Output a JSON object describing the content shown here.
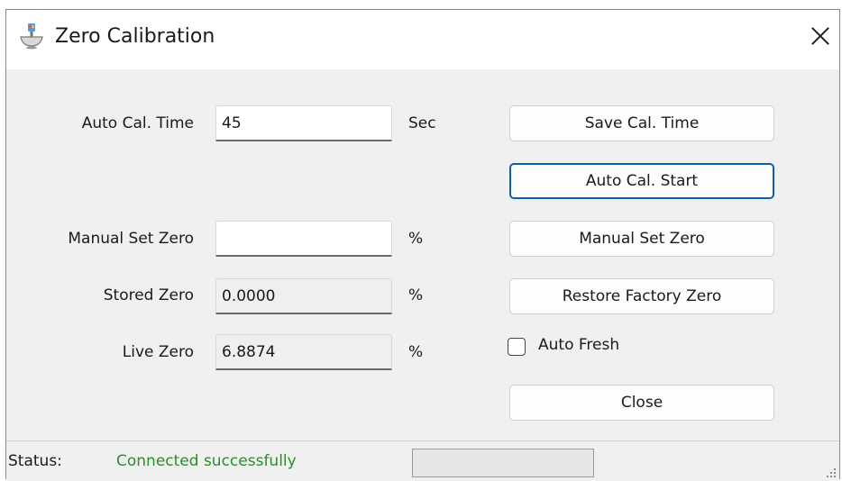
{
  "window": {
    "title": "Zero Calibration",
    "icon": "calibration-icon"
  },
  "form": {
    "auto_cal_time": {
      "label": "Auto Cal. Time",
      "value": "45",
      "unit": "Sec"
    },
    "manual_set_zero": {
      "label": "Manual Set Zero",
      "value": "",
      "unit": "%"
    },
    "stored_zero": {
      "label": "Stored Zero",
      "value": "0.0000",
      "unit": "%"
    },
    "live_zero": {
      "label": "Live Zero",
      "value": "6.8874",
      "unit": "%"
    }
  },
  "buttons": {
    "save_cal_time": "Save Cal. Time",
    "auto_cal_start": "Auto Cal. Start",
    "manual_set_zero": "Manual Set Zero",
    "restore_factory_zero": "Restore Factory Zero",
    "close": "Close"
  },
  "auto_fresh": {
    "label": "Auto Fresh",
    "checked": false
  },
  "status": {
    "label": "Status:",
    "value": "Connected successfully",
    "value_color": "#2e8b2e",
    "progress": 0
  },
  "colors": {
    "focus_border": "#0a5fb4"
  }
}
